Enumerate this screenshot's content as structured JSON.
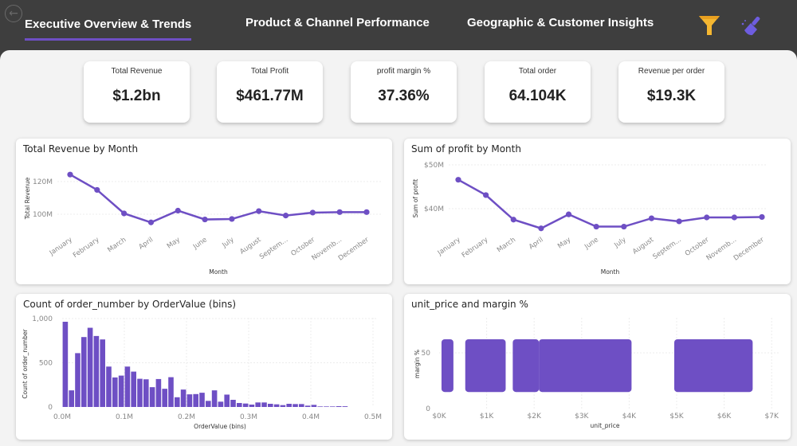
{
  "header": {
    "tabs": [
      {
        "label": "Executive Overview & Trends",
        "active": true
      },
      {
        "label": "Product & Channel Performance",
        "active": false
      },
      {
        "label": "Geographic & Customer Insights",
        "active": false
      }
    ],
    "icons": {
      "back": "back-arrow-icon",
      "filter": "funnel-icon",
      "clear": "eraser-brush-icon"
    },
    "accent": "#6e4fc4"
  },
  "kpis": [
    {
      "label": "Total Revenue",
      "value": "$1.2bn"
    },
    {
      "label": "Total Profit",
      "value": "$461.77M"
    },
    {
      "label": "profit margin %",
      "value": "37.36%"
    },
    {
      "label": "Total order",
      "value": "64.104K"
    },
    {
      "label": "Revenue per order",
      "value": "$19.3K"
    }
  ],
  "chart_data": [
    {
      "type": "line",
      "title": "Total Revenue by Month",
      "xlabel": "Month",
      "ylabel": "Total Revenue",
      "categories": [
        "January",
        "February",
        "March",
        "April",
        "May",
        "June",
        "July",
        "August",
        "Septem...",
        "October",
        "Novemb...",
        "December"
      ],
      "values": [
        124.3,
        114.9,
        100.5,
        95.0,
        102.2,
        96.8,
        97.1,
        101.9,
        99.2,
        101.0,
        101.3,
        101.3
      ],
      "units": "M",
      "yticks": [
        {
          "v": 100,
          "label": "100M"
        },
        {
          "v": 120,
          "label": "120M"
        }
      ],
      "color": "#6e4fc4"
    },
    {
      "type": "line",
      "title": "Sum of profit by Month",
      "xlabel": "Month",
      "ylabel": "Sum of profit",
      "categories": [
        "January",
        "February",
        "March",
        "April",
        "May",
        "June",
        "July",
        "August",
        "Septem...",
        "October",
        "Novemb...",
        "December"
      ],
      "values": [
        46.6,
        43.1,
        37.5,
        35.5,
        38.7,
        35.9,
        35.9,
        37.8,
        37.1,
        38.0,
        38.0,
        38.1
      ],
      "units": "M",
      "yticks": [
        {
          "v": 40,
          "label": "$40M"
        },
        {
          "v": 50,
          "label": "$50M"
        }
      ],
      "color": "#6e4fc4"
    },
    {
      "type": "bar",
      "title": "Count of order_number by OrderValue (bins)",
      "xlabel": "OrderValue (bins)",
      "ylabel": "Count of order_number",
      "bin_width_M": 0.01,
      "values": [
        964,
        188,
        609,
        791,
        896,
        803,
        764,
        457,
        334,
        355,
        457,
        400,
        319,
        313,
        224,
        316,
        206,
        337,
        110,
        197,
        143,
        146,
        161,
        69,
        188,
        60,
        140,
        81,
        45,
        39,
        27,
        51,
        51,
        36,
        30,
        21,
        36,
        33,
        33,
        15,
        24,
        6,
        6,
        6,
        9,
        8
      ],
      "xlim": [
        0,
        0.5
      ],
      "ylim": [
        0,
        1000
      ],
      "xticks": [
        {
          "v": 0,
          "label": "0.0M"
        },
        {
          "v": 0.1,
          "label": "0.1M"
        },
        {
          "v": 0.2,
          "label": "0.2M"
        },
        {
          "v": 0.3,
          "label": "0.3M"
        },
        {
          "v": 0.4,
          "label": "0.4M"
        },
        {
          "v": 0.5,
          "label": "0.5M"
        }
      ],
      "yticks": [
        {
          "v": 0,
          "label": "0"
        },
        {
          "v": 500,
          "label": "500"
        },
        {
          "v": 1000,
          "label": "1,000"
        }
      ],
      "color": "#6e4fc4"
    },
    {
      "type": "scatter",
      "title": "unit_price and margin %",
      "xlabel": "unit_price",
      "ylabel": "margin %",
      "xlim": [
        0,
        7
      ],
      "ylim": [
        0,
        60
      ],
      "clusters_note_units": "x in $K, y in margin %",
      "clusters": [
        {
          "x": [
            0.1,
            0.25
          ],
          "y": [
            17,
            60
          ]
        },
        {
          "x": [
            0.6,
            1.35
          ],
          "y": [
            17,
            60
          ]
        },
        {
          "x": [
            1.6,
            2.05
          ],
          "y": [
            17,
            60
          ]
        },
        {
          "x": [
            2.15,
            4.0
          ],
          "y": [
            17,
            60
          ]
        },
        {
          "x": [
            5.0,
            6.55
          ],
          "y": [
            17,
            60
          ]
        }
      ],
      "xticks": [
        {
          "v": 0,
          "label": "$0K"
        },
        {
          "v": 1,
          "label": "$1K"
        },
        {
          "v": 2,
          "label": "$2K"
        },
        {
          "v": 3,
          "label": "$3K"
        },
        {
          "v": 4,
          "label": "$4K"
        },
        {
          "v": 5,
          "label": "$5K"
        },
        {
          "v": 6,
          "label": "$6K"
        },
        {
          "v": 7,
          "label": "$7K"
        }
      ],
      "yticks": [
        {
          "v": 0,
          "label": "0"
        },
        {
          "v": 50,
          "label": "50"
        }
      ],
      "color": "#6e4fc4"
    }
  ]
}
